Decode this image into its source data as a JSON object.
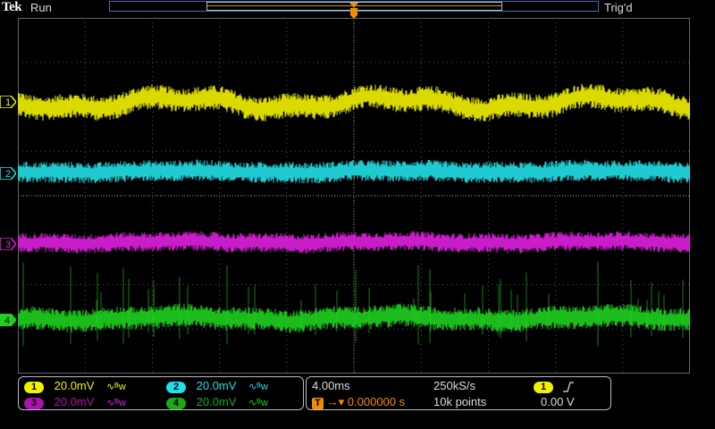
{
  "header": {
    "logo": "Tek",
    "run_state": "Run",
    "trigger_state": "Trig'd",
    "trigger_marker": "T"
  },
  "channels": [
    {
      "id": "1",
      "label": "1",
      "color": "#f2f200",
      "scale": "20.0mV",
      "coupling": "∿ᴮw"
    },
    {
      "id": "2",
      "label": "2",
      "color": "#22e0e8",
      "scale": "20.0mV",
      "coupling": "∿ᴮw"
    },
    {
      "id": "3",
      "label": "3",
      "color": "#e020e0",
      "scale": "20.0mV",
      "coupling": "∿ᴮw"
    },
    {
      "id": "4",
      "label": "4",
      "color": "#20d020",
      "scale": "20.0mV",
      "coupling": "∿ᴮw"
    }
  ],
  "timebase": {
    "horizontal_scale": "4.00ms",
    "sample_rate": "250kS/s",
    "trigger_delay": "0.000000 s",
    "record_length": "10k points"
  },
  "trigger": {
    "source": "1",
    "slope_icon": "rising-edge-icon",
    "level": "0.00 V"
  }
}
